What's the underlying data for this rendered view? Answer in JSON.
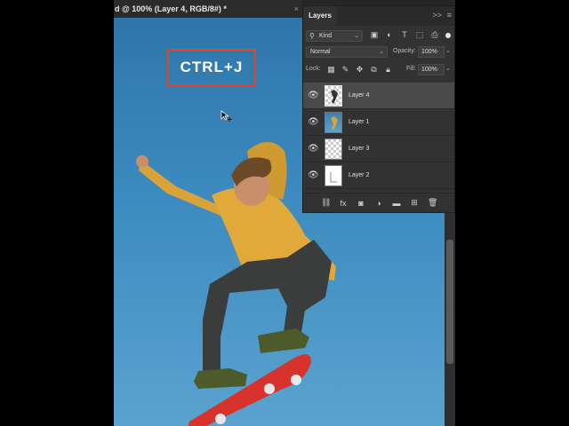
{
  "document": {
    "tab_title": "d @ 100% (Layer 4, RGB/8#) *",
    "close_glyph": "×"
  },
  "canvas": {
    "shortcut_text": "CTRL+J",
    "shortcut_box_color": "#e0442a",
    "sky_colors": [
      "#2e76aa",
      "#5aa3cf"
    ]
  },
  "layers_panel": {
    "title": "Layers",
    "collapse_glyph": ">>",
    "menu_glyph": "≡",
    "filter": {
      "label": "Kind",
      "icons": [
        "image-filter-icon",
        "adjustment-filter-icon",
        "type-filter-icon",
        "shape-filter-icon",
        "smart-object-filter-icon"
      ]
    },
    "blend_mode": "Normal",
    "opacity_label": "Opacity:",
    "opacity_value": "100%",
    "lock_label": "Lock:",
    "fill_label": "Fill:",
    "fill_value": "100%",
    "layers": [
      {
        "name": "Layer 4",
        "selected": true,
        "thumb": "transparent",
        "visible": true
      },
      {
        "name": "Layer 1",
        "selected": false,
        "thumb": "photo",
        "visible": true
      },
      {
        "name": "Layer 3",
        "selected": false,
        "thumb": "transparent",
        "visible": true
      },
      {
        "name": "Layer 2",
        "selected": false,
        "thumb": "white",
        "visible": true
      }
    ],
    "selected_color": "#4a4a4a"
  }
}
